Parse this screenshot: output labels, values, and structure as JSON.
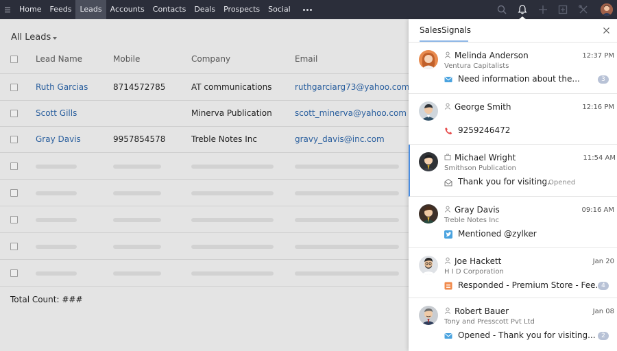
{
  "nav": {
    "items": [
      {
        "label": "Home",
        "active": false
      },
      {
        "label": "Feeds",
        "active": false
      },
      {
        "label": "Leads",
        "active": true
      },
      {
        "label": "Accounts",
        "active": false
      },
      {
        "label": "Contacts",
        "active": false
      },
      {
        "label": "Deals",
        "active": false
      },
      {
        "label": "Prospects",
        "active": false
      },
      {
        "label": "Social",
        "active": false
      }
    ],
    "icons": [
      "menu-icon",
      "more-icon",
      "search-icon",
      "bell-icon",
      "plus-icon",
      "calendar-icon",
      "tools-icon",
      "user-avatar"
    ]
  },
  "leads": {
    "view_title": "All Leads",
    "columns": [
      "Lead Name",
      "Mobile",
      "Company",
      "Email"
    ],
    "rows": [
      {
        "name": "Ruth Garcias",
        "mobile": "8714572785",
        "company": "AT communications",
        "email": "ruthgarciarg73@yahoo.com"
      },
      {
        "name": "Scott Gills",
        "mobile": "",
        "company": "Minerva Publication",
        "email": "scott_minerva@yahoo.com"
      },
      {
        "name": "Gray Davis",
        "mobile": "9957854578",
        "company": "Treble Notes Inc",
        "email": "gravy_davis@inc.com"
      }
    ],
    "total_count": "Total Count: ###"
  },
  "signals": {
    "title": "SalesSignals",
    "items": [
      {
        "name": "Melinda Anderson",
        "time": "12:37 PM",
        "company": "Ventura Capitalists",
        "message": "Need information about the...",
        "type": "email-icon",
        "badge": "3",
        "status": ""
      },
      {
        "name": "George Smith",
        "time": "12:16 PM",
        "company": "",
        "message": "9259246472",
        "type": "missed-call-icon",
        "badge": "",
        "status": ""
      },
      {
        "name": "Michael Wright",
        "time": "11:54 AM",
        "company": "Smithson Publication",
        "message": "Thank you for visiting...",
        "type": "email-opened-icon",
        "badge": "",
        "status": "Opened"
      },
      {
        "name": "Gray Davis",
        "time": "09:16 AM",
        "company": "Treble Notes Inc",
        "message": "Mentioned @zylker",
        "type": "twitter-icon",
        "badge": "",
        "status": ""
      },
      {
        "name": "Joe Hackett",
        "time": "Jan 20",
        "company": "H I D Corporation",
        "message": "Responded - Premium Store - Fee...",
        "type": "survey-icon",
        "badge": "4",
        "status": ""
      },
      {
        "name": "Robert Bauer",
        "time": "Jan 08",
        "company": "Tony and Presscott Pvt Ltd",
        "message": "Opened - Thank you for visiting...",
        "type": "email-icon",
        "badge": "2",
        "status": ""
      }
    ]
  }
}
